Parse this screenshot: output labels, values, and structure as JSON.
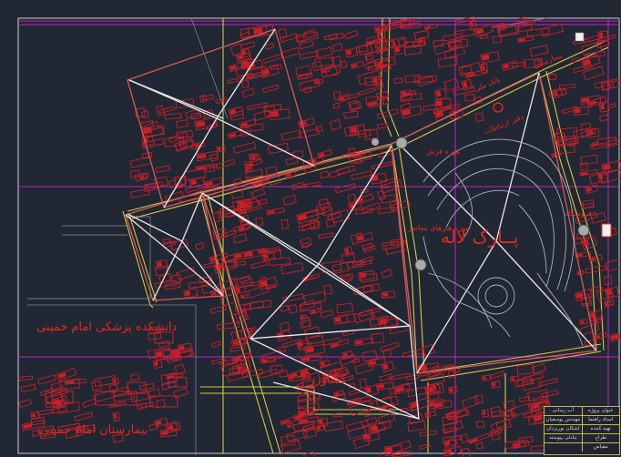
{
  "drawing": {
    "background_color": "#212733",
    "colors": {
      "building": "#c8202a",
      "street": "#d9c84a",
      "grid": "#c026c0",
      "diagram": "#e8e8e8",
      "block_outline": "#d65a5a",
      "border": "#cfcfcf"
    }
  },
  "labels": {
    "park_name": "پــارک لاله",
    "medical_school": "دانشکده پزشکی امام خمینی",
    "hospital": "بیمارستان امام خمینی",
    "street_keshavarz": "کشاورز",
    "label_pc_1": "دفتر ارتباطات",
    "label_pc_2": "بانک ملی",
    "label_pc_3": "موزه هنرهای معاصر",
    "label_pc_4": "موزه فرش",
    "label_pc_5": "فروشگاه",
    "label_pc_6": "بیمارستان"
  },
  "title_block": {
    "rows": [
      [
        "عنوان پروژه",
        "آب رسانی"
      ],
      [
        "استاد راهنما",
        "مهندس یوسفیان"
      ],
      [
        "تهیه کننده",
        "اشکان نوریزدان"
      ],
      [
        "طراح",
        "تبادلی پیوسته"
      ],
      [
        "مقیاس",
        ""
      ]
    ]
  }
}
